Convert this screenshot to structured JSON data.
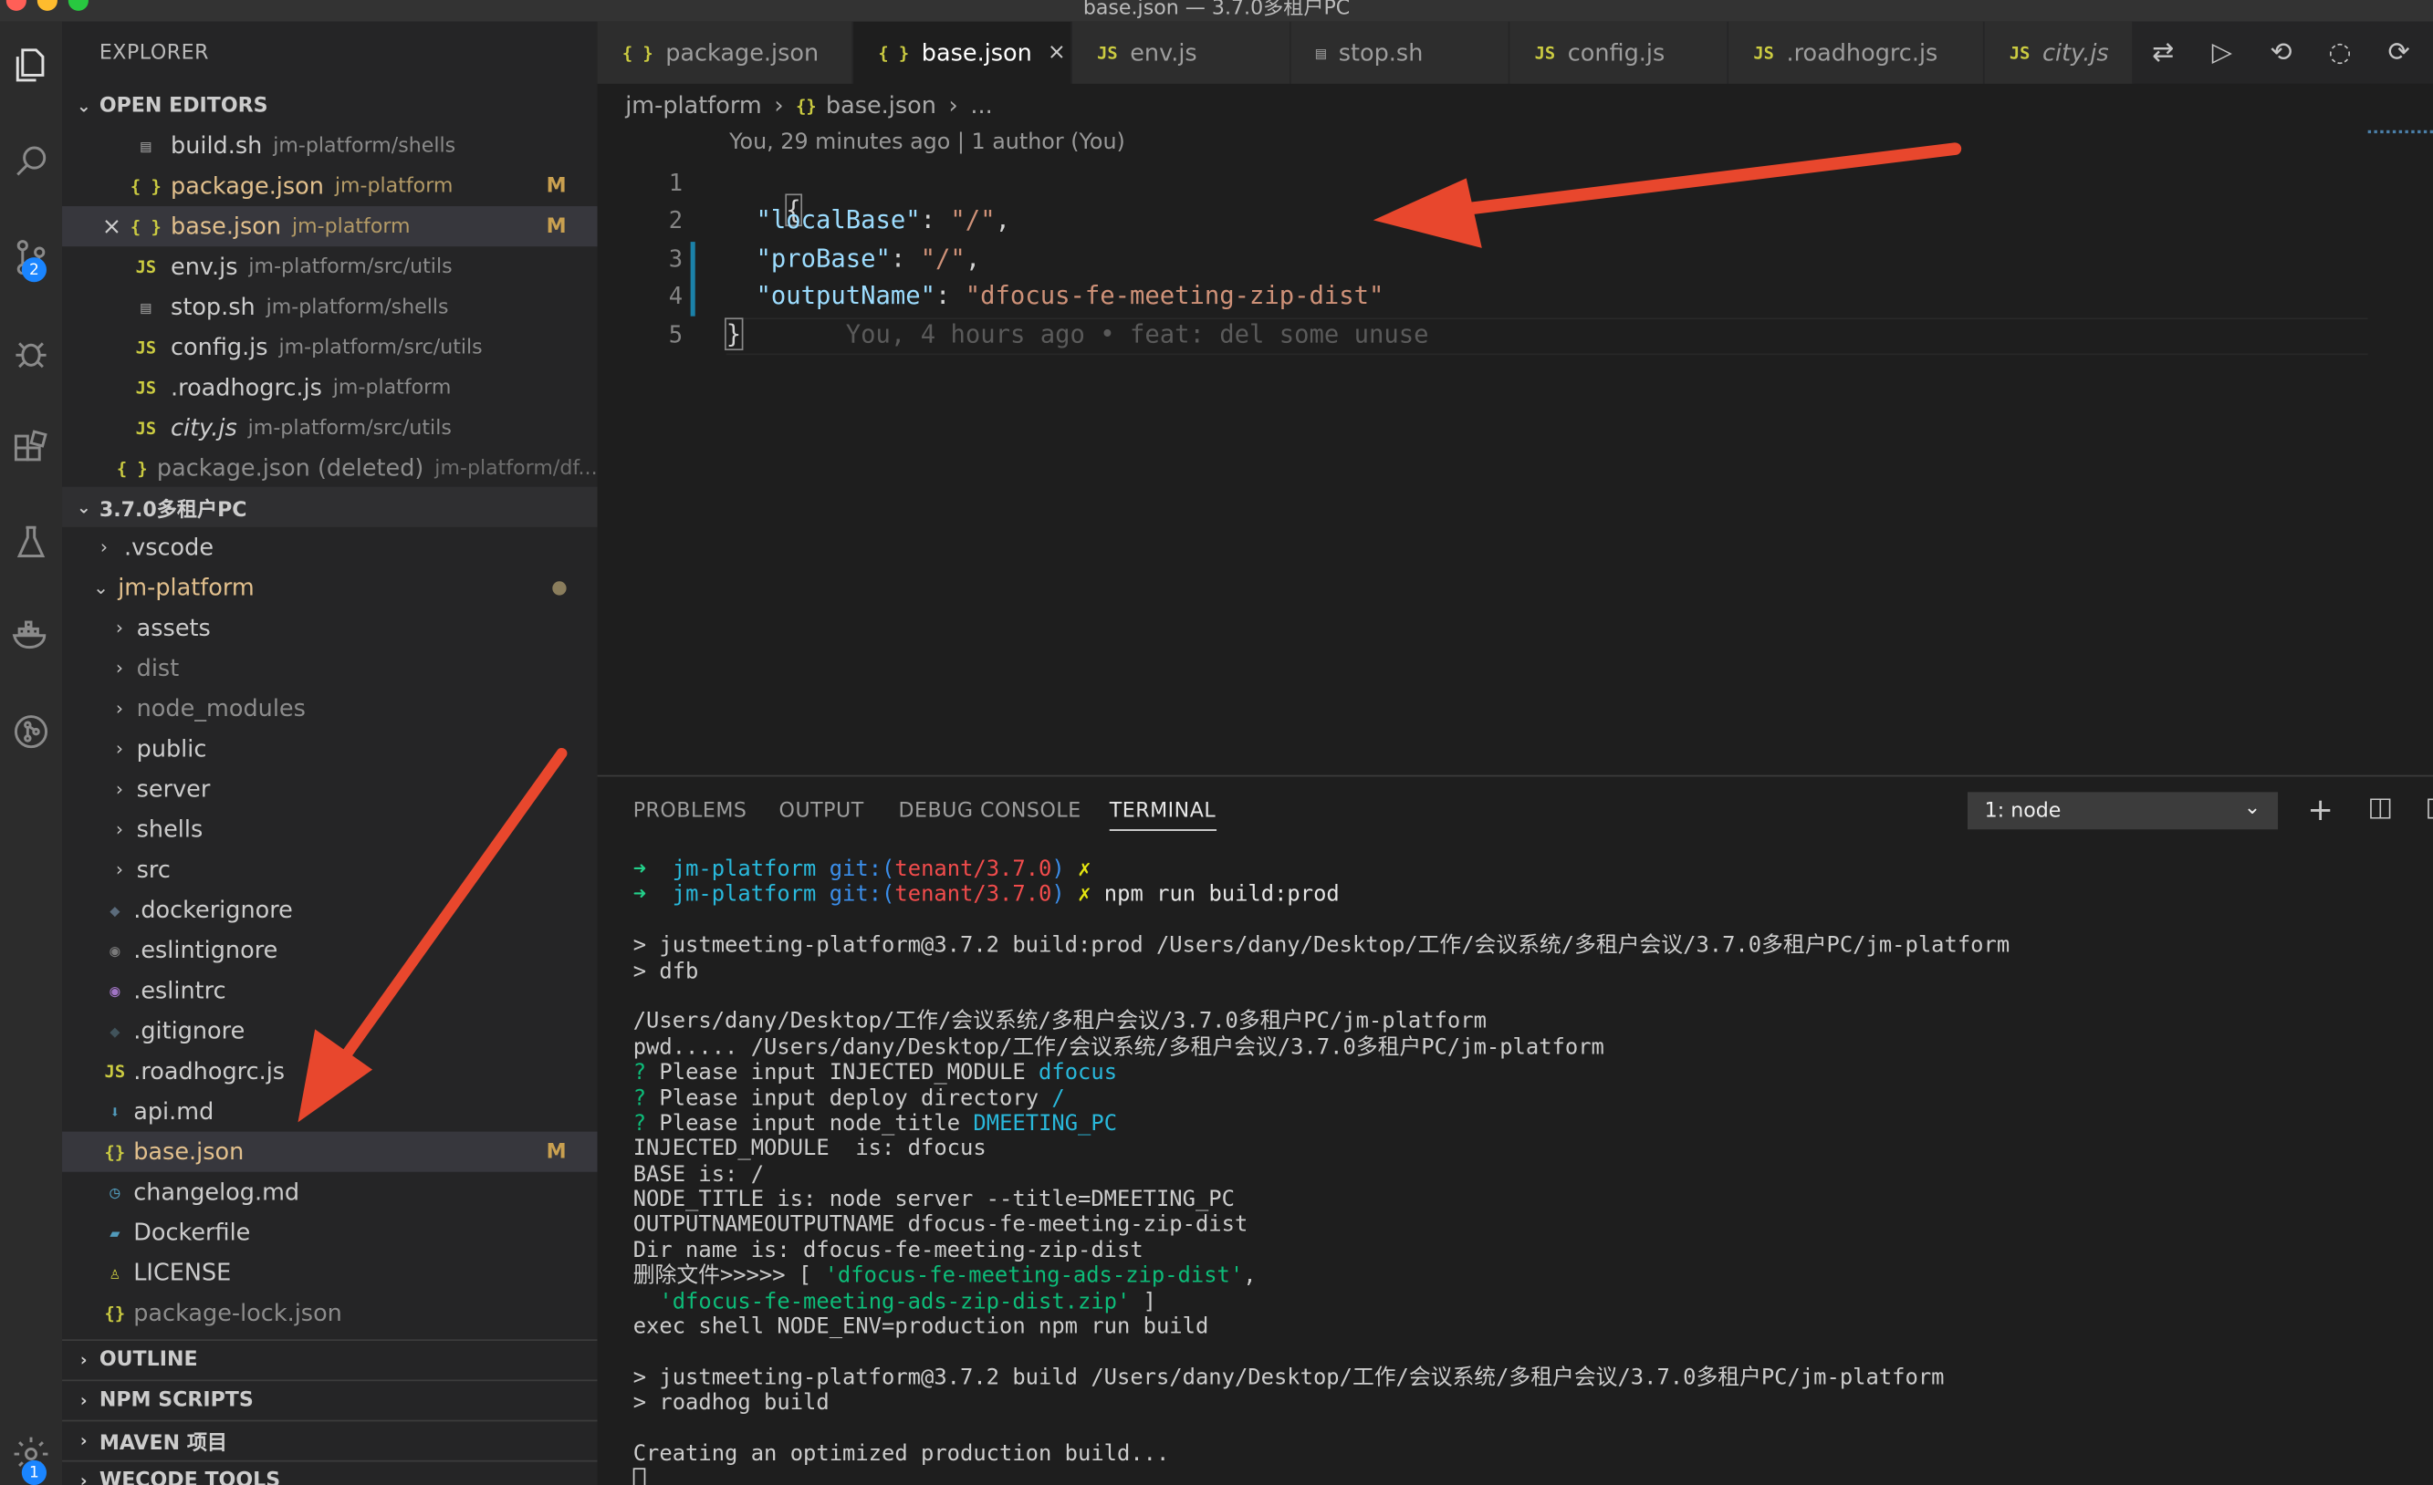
{
  "window": {
    "title": "base.json — 3.7.0多租户PC"
  },
  "activity_bar": {
    "scm_badge": "2",
    "manage_badge": "1"
  },
  "sidebar": {
    "title": "EXPLORER",
    "open_editors": {
      "header": "OPEN EDITORS",
      "items": [
        {
          "icon": "▤",
          "name": "build.sh",
          "dir": "jm-platform/shells",
          "status": ""
        },
        {
          "icon": "{ }",
          "name": "package.json",
          "dir": "jm-platform",
          "status": "M"
        },
        {
          "icon": "{ }",
          "name": "base.json",
          "dir": "jm-platform",
          "status": "M"
        },
        {
          "icon": "JS",
          "name": "env.js",
          "dir": "jm-platform/src/utils",
          "status": ""
        },
        {
          "icon": "▤",
          "name": "stop.sh",
          "dir": "jm-platform/shells",
          "status": ""
        },
        {
          "icon": "JS",
          "name": "config.js",
          "dir": "jm-platform/src/utils",
          "status": ""
        },
        {
          "icon": "JS",
          "name": ".roadhogrc.js",
          "dir": "jm-platform",
          "status": ""
        },
        {
          "icon": "JS",
          "name": "city.js",
          "dir": "jm-platform/src/utils",
          "status": ""
        },
        {
          "icon": "{ }",
          "name": "package.json (deleted)",
          "dir": "jm-platform/df...",
          "status": ""
        }
      ]
    },
    "workspace": {
      "header": "3.7.0多租户PC",
      "items": [
        {
          "name": ".vscode"
        },
        {
          "name": "jm-platform"
        },
        {
          "name": "assets"
        },
        {
          "name": "dist"
        },
        {
          "name": "node_modules"
        },
        {
          "name": "public"
        },
        {
          "name": "server"
        },
        {
          "name": "shells"
        },
        {
          "name": "src"
        },
        {
          "name": ".dockerignore"
        },
        {
          "name": ".eslintignore"
        },
        {
          "name": ".eslintrc"
        },
        {
          "name": ".gitignore"
        },
        {
          "name": ".roadhogrc.js"
        },
        {
          "name": "api.md"
        },
        {
          "name": "base.json",
          "status": "M"
        },
        {
          "name": "changelog.md"
        },
        {
          "name": "Dockerfile"
        },
        {
          "name": "LICENSE"
        },
        {
          "name": "package-lock.json"
        }
      ]
    },
    "sections": [
      "OUTLINE",
      "NPM SCRIPTS",
      "MAVEN 项目",
      "WECODE TOOLS"
    ]
  },
  "tabs": [
    {
      "icon": "{ }",
      "label": "package.json"
    },
    {
      "icon": "{ }",
      "label": "base.json",
      "close": "×"
    },
    {
      "icon": "JS",
      "label": "env.js"
    },
    {
      "icon": "▤",
      "label": "stop.sh"
    },
    {
      "icon": "JS",
      "label": "config.js"
    },
    {
      "icon": "JS",
      "label": ".roadhogrc.js"
    },
    {
      "icon": "JS",
      "label": "city.js"
    }
  ],
  "breadcrumb": {
    "folder": "jm-platform",
    "sep": "›",
    "file": "base.json",
    "more": "..."
  },
  "editor": {
    "codelens": "You, 29 minutes ago | 1 author (You)",
    "line_numbers": [
      "1",
      "2",
      "3",
      "4",
      "5"
    ],
    "lines": {
      "l1": "{",
      "l2_key": "\"localBase\"",
      "l2_colon": ": ",
      "l2_val": "\"/\"",
      "l2_end": ",",
      "l3_key": "\"proBase\"",
      "l3_colon": ": ",
      "l3_val": "\"/\"",
      "l3_end": ",",
      "l4_key": "\"outputName\"",
      "l4_colon": ": ",
      "l4_val": "\"dfocus-fe-meeting-zip-dist\"",
      "l5": "}",
      "blame": "You, 4 hours ago • feat: del some unuse"
    }
  },
  "panel": {
    "tabs": [
      "PROBLEMS",
      "OUTPUT",
      "DEBUG CONSOLE",
      "TERMINAL"
    ],
    "terminal_select": "1: node",
    "terminal": {
      "p_arrow": "➜",
      "p_dir": "jm-platform",
      "p_git": "git:(",
      "p_branch": "tenant/3.7.0",
      "p_close": ")",
      "p_x": "✗",
      "cmd": "npm run build:prod",
      "l3": "> justmeeting-platform@3.7.2 build:prod /Users/dany/Desktop/工作/会议系统/多租户会议/3.7.0多租户PC/jm-platform",
      "l4": "> dfb",
      "l6": "/Users/dany/Desktop/工作/会议系统/多租户会议/3.7.0多租户PC/jm-platform",
      "l7": "pwd..... /Users/dany/Desktop/工作/会议系统/多租户会议/3.7.0多租户PC/jm-platform",
      "q": "?",
      "q1": "Please input INJECTED_MODULE",
      "a1": "dfocus",
      "q2": "Please input deploy directory",
      "a2": "/",
      "q3": "Please input node_title",
      "a3": "DMEETING_PC",
      "l11": "INJECTED_MODULE  is: dfocus",
      "l12": "BASE is: /",
      "l13": "NODE_TITLE is: node server --title=DMEETING_PC",
      "l14": "OUTPUTNAMEOUTPUTNAME dfocus-fe-meeting-zip-dist",
      "l15": "Dir name is: dfocus-fe-meeting-zip-dist",
      "l16a": "删除文件>>>>> [ ",
      "l16b": "'dfocus-fe-meeting-ads-zip-dist'",
      "l16c": ",",
      "l17a": "  ",
      "l17b": "'dfocus-fe-meeting-ads-zip-dist.zip'",
      "l17c": " ]",
      "l18": "exec shell NODE_ENV=production npm run build",
      "l20": "> justmeeting-platform@3.7.2 build /Users/dany/Desktop/工作/会议系统/多租户会议/3.7.0多租户PC/jm-platform",
      "l21": "> roadhog build",
      "l23": "Creating an optimized production build..."
    }
  },
  "colors": {
    "annotation_arrow": "#e8472d",
    "accent": "#1a85ff"
  }
}
